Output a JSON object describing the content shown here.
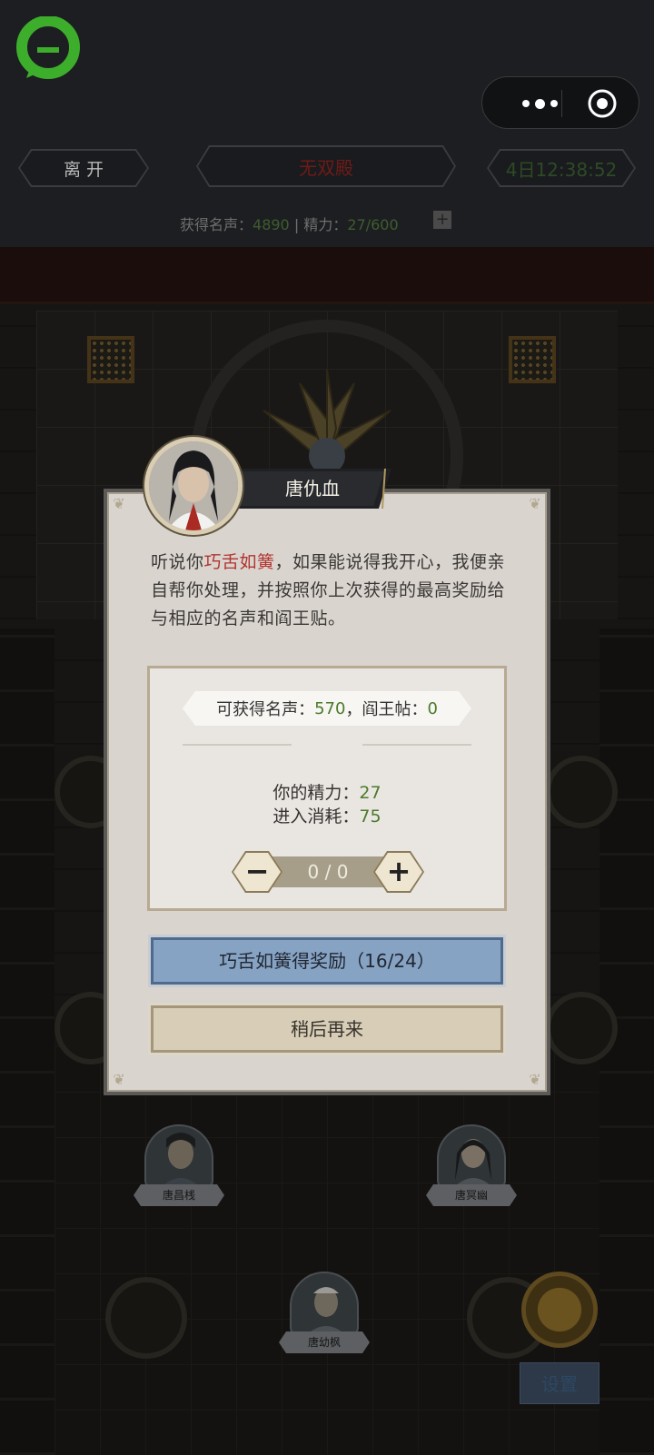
{
  "topbar": {
    "leave_label": "离 开",
    "location_label": "无双殿",
    "timer_label": "4日12:38:52",
    "fame_label": "获得名声：",
    "fame_value": "4890",
    "energy_label": "精力：",
    "energy_value": "27/600",
    "separator": "|",
    "plus_label": "+"
  },
  "dialog": {
    "character_name": "唐仇血",
    "description_parts": [
      "听说你",
      "巧舌如簧",
      "，如果能说得我开心，我便亲自帮你处理，并按照你上次获得的最高奖励给与相应的名声和阎王贴。"
    ],
    "reward_label_prefix": "可获得名声：",
    "reward_fame": "570",
    "reward_ticket_label": "，阎王帖：",
    "reward_ticket": "0",
    "energy_label": "你的精力：",
    "energy_value": "27",
    "cost_label": "进入消耗：",
    "cost_value": "75",
    "stepper_value": "0 / 0",
    "minus_label": "−",
    "plus_label": "+",
    "primary_button": "巧舌如簧得奖励（16/24）",
    "secondary_button": "稍后再来"
  },
  "scene": {
    "characters": [
      {
        "name": "唐昌桟"
      },
      {
        "name": "唐冥幽"
      },
      {
        "name": "唐幼枫"
      }
    ],
    "settings_label": "设置"
  },
  "colors": {
    "highlight_red": "#b3332e",
    "value_green": "#4c7a2b",
    "primary_button": "#87a3c4",
    "logo_green": "#3dae2b"
  }
}
